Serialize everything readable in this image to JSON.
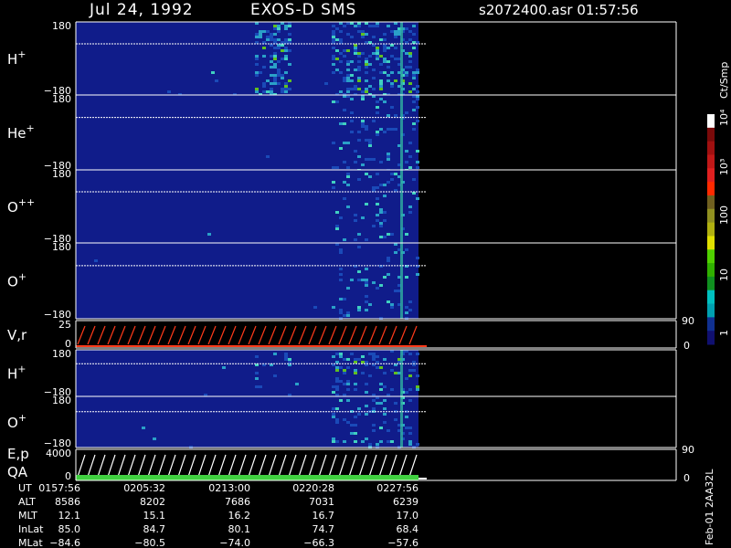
{
  "header": {
    "date": "Jul 24, 1992",
    "instrument": "EXOS-D SMS",
    "file_time": "s2072400.asr  01:57:56"
  },
  "chart_data": {
    "type": "heatmap",
    "panels": [
      {
        "label_main": "H",
        "label_sup": "+",
        "y_top": "180",
        "y_bottom": "−180",
        "right_label": "",
        "right_bottom_label": ""
      },
      {
        "label_main": "He",
        "label_sup": "+",
        "y_top": "180",
        "y_bottom": "−180",
        "right_label": "",
        "right_bottom_label": ""
      },
      {
        "label_main": "O",
        "label_sup": "++",
        "y_top": "180",
        "y_bottom": "−180",
        "right_label": "",
        "right_bottom_label": ""
      },
      {
        "label_main": "O",
        "label_sup": "+",
        "y_top": "180",
        "y_bottom": "−180",
        "right_label": "",
        "right_bottom_label": ""
      },
      {
        "label_main": "V,r",
        "label_sup": "",
        "y_top": "25",
        "y_bottom": "0",
        "right_label": "90",
        "right_bottom_label": "0"
      },
      {
        "label_main": "H",
        "label_sup": "+",
        "y_top": "180",
        "y_bottom": "−180",
        "right_label": "",
        "right_bottom_label": ""
      },
      {
        "label_main": "O",
        "label_sup": "+",
        "y_top": "180",
        "y_bottom": "−180",
        "right_label": "",
        "right_bottom_label": ""
      },
      {
        "label_main": "E,p",
        "label_sup": "",
        "label2": "QA",
        "y_top": "4000",
        "y_bottom": "0",
        "right_label": "90",
        "right_bottom_label": "0"
      }
    ],
    "colorbar": {
      "unit": "Ct/Smp",
      "tick_labels": [
        "10⁴",
        "10³",
        "100",
        "10",
        "1"
      ],
      "colors": [
        "#ffffff",
        "#7a0a0a",
        "#a01010",
        "#c01818",
        "#e02020",
        "#ff2a00",
        "#706020",
        "#909020",
        "#b0b010",
        "#e0e000",
        "#50d000",
        "#30b000",
        "#109020",
        "#00c0c0",
        "#00a0b0",
        "#103090",
        "#101070"
      ]
    },
    "time_table": {
      "row_labels": [
        "UT",
        "ALT",
        "MLT",
        "InLat",
        "MLat"
      ],
      "columns": [
        [
          "0157:56",
          "8586",
          "12.1",
          "85.0",
          "−84.6"
        ],
        [
          "0205:32",
          "8202",
          "15.1",
          "84.7",
          "−80.5"
        ],
        [
          "0213:00",
          "7686",
          "16.2",
          "80.1",
          "−74.0"
        ],
        [
          "0220:28",
          "7031",
          "16.7",
          "74.7",
          "−66.3"
        ],
        [
          "0227:56",
          "6239",
          "17.0",
          "68.4",
          "−57.6"
        ]
      ]
    },
    "footer_note": "Feb-01 2AA32L"
  }
}
